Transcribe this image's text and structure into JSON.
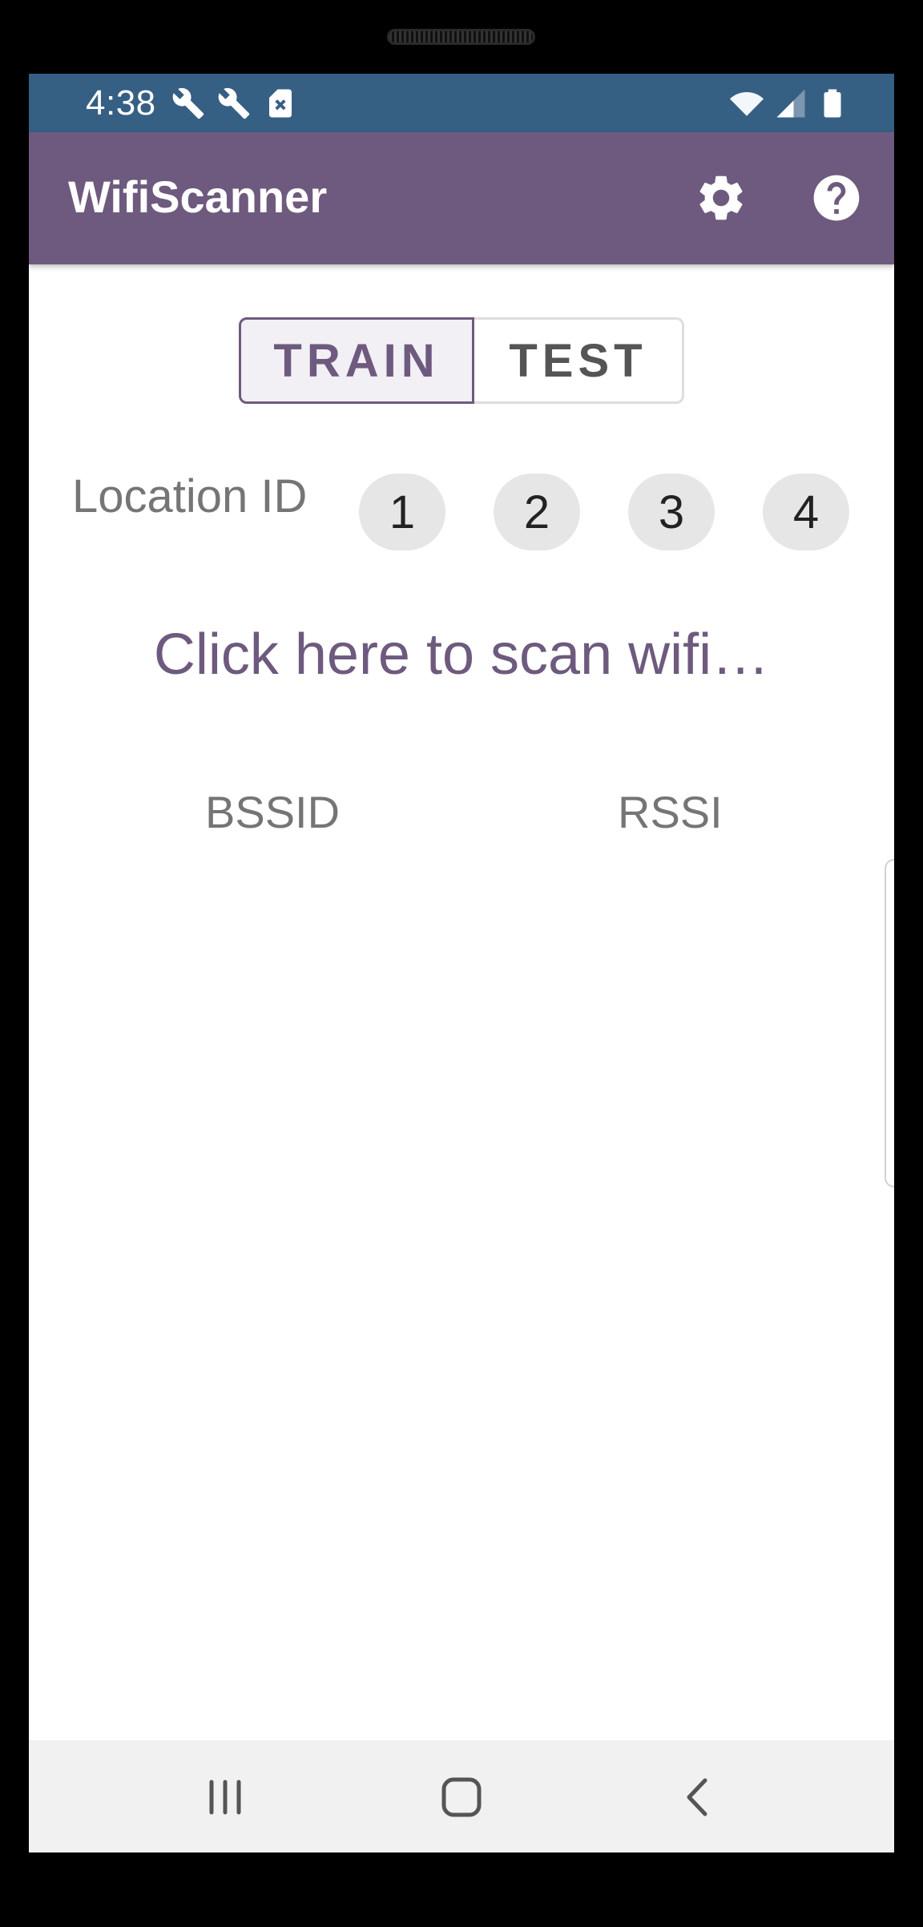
{
  "status_bar": {
    "time": "4:38",
    "left_icons": [
      "wrench-icon",
      "wrench-icon",
      "sim-error-icon"
    ],
    "right_icons": [
      "wifi-icon",
      "signal-icon",
      "battery-icon"
    ],
    "background": "#365f84"
  },
  "app_bar": {
    "title": "WifiScanner",
    "actions": [
      "settings-icon",
      "help-icon"
    ],
    "background": "#6e5a7e"
  },
  "mode_toggle": {
    "options": [
      {
        "label": "TRAIN",
        "selected": true
      },
      {
        "label": "TEST",
        "selected": false
      }
    ]
  },
  "location": {
    "label": "Location ID",
    "ids": [
      "1",
      "2",
      "3",
      "4"
    ]
  },
  "scan": {
    "label": "Click here to scan wifi…"
  },
  "table": {
    "columns": [
      "BSSID",
      "RSSI"
    ]
  },
  "nav_bar": {
    "buttons": [
      "recent-apps-icon",
      "home-icon",
      "back-icon"
    ]
  },
  "colors": {
    "accent": "#6e5a7e",
    "status": "#365f84"
  }
}
